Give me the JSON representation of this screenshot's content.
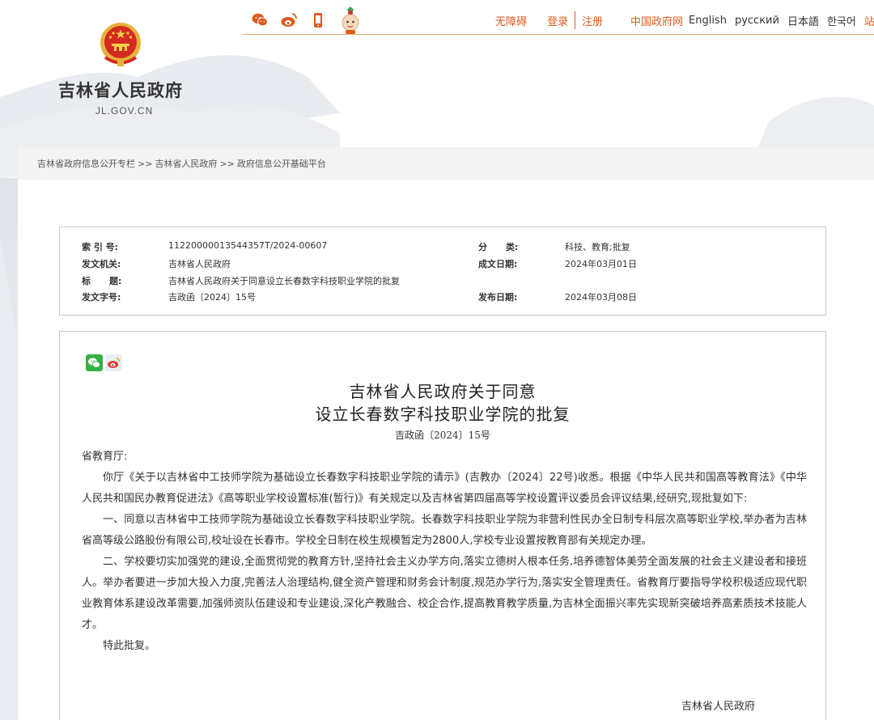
{
  "header": {
    "site_title": "吉林省人民政府",
    "site_domain": "JL.GOV.CN",
    "social_icons": [
      "wechat-icon",
      "weibo-icon",
      "mobile-icon",
      "mascot-icon"
    ],
    "links": {
      "accessible": "无障碍",
      "login": "登录",
      "register": "注册",
      "china_gov": "中国政府网",
      "english": "English",
      "russian": "русский",
      "japanese": "日本語",
      "korean": "한국어",
      "more": "站群导"
    },
    "accent_color": "#e05a1e"
  },
  "breadcrumb": {
    "items": [
      "吉林省政府信息公开专栏",
      "吉林省人民政府",
      "政府信息公开基础平台"
    ],
    "separator": ">>"
  },
  "info": {
    "index_label": "索 引 号:",
    "index_value": "11220000013544357T/2024-00607",
    "category_label": "分      类:",
    "category_value": "科技、教育;批复",
    "issuer_label": "发文机关:",
    "issuer_value": "吉林省人民政府",
    "created_label": "成文日期:",
    "created_value": "2024年03月01日",
    "title_label": "标      题:",
    "title_value": "吉林省人民政府关于同意设立长春数字科技职业学院的批复",
    "docno_label": "发文字号:",
    "docno_value": "吉政函〔2024〕15号",
    "published_label": "发布日期:",
    "published_value": "2024年03月08日"
  },
  "document": {
    "title_line1": "吉林省人民政府关于同意",
    "title_line2": "设立长春数字科技职业学院的批复",
    "doc_number": "吉政函〔2024〕15号",
    "salutation": "省教育厅:",
    "paragraphs": [
      "你厅《关于以吉林省中工技师学院为基础设立长春数字科技职业学院的请示》(吉教办〔2024〕22号)收悉。根据《中华人民共和国高等教育法》《中华人民共和国民办教育促进法》《高等职业学校设置标准(暂行)》有关规定以及吉林省第四届高等学校设置评议委员会评议结果,经研究,现批复如下:",
      "一、同意以吉林省中工技师学院为基础设立长春数字科技职业学院。长春数字科技职业学院为非营利性民办全日制专科层次高等职业学校,举办者为吉林省高等级公路股份有限公司,校址设在长春市。学校全日制在校生规模暂定为2800人,学校专业设置按教育部有关规定办理。",
      "二、学校要切实加强党的建设,全面贯彻党的教育方针,坚持社会主义办学方向,落实立德树人根本任务,培养德智体美劳全面发展的社会主义建设者和接班人。举办者要进一步加大投入力度,完善法人治理结构,健全资产管理和财务会计制度,规范办学行为,落实安全管理责任。省教育厅要指导学校积极适应现代职业教育体系建设改革需要,加强师资队伍建设和专业建设,深化产教融合、校企合作,提高教育教学质量,为吉林全面振兴率先实现新突破培养高素质技术技能人才。",
      "特此批复。"
    ],
    "signature": "吉林省人民政府"
  }
}
